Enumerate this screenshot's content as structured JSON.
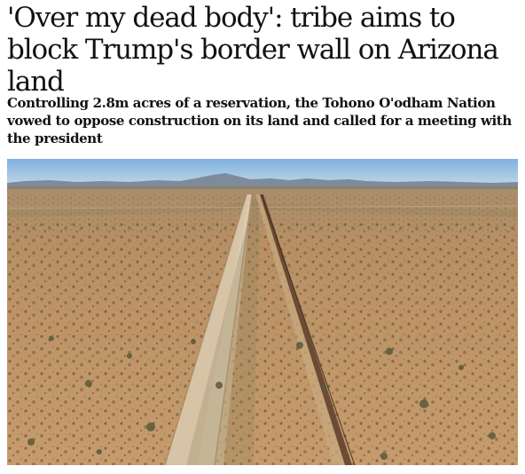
{
  "article": {
    "headline": "'Over my dead body': tribe aims to block Trump's border wall on Arizona land",
    "standfirst": "Controlling 2.8m acres of a reservation, the Tohono O'odham Nation vowed to oppose construction on its land and called for a meeting with the president"
  },
  "photo": {
    "sky_color": "#8fb8dc",
    "mountain_color": "#8391a0",
    "desert_color": "#c59a6d",
    "road_color": "#d8c3a6",
    "wall_color": "#6b4a34",
    "shrub_color": "#5d5a3b"
  }
}
